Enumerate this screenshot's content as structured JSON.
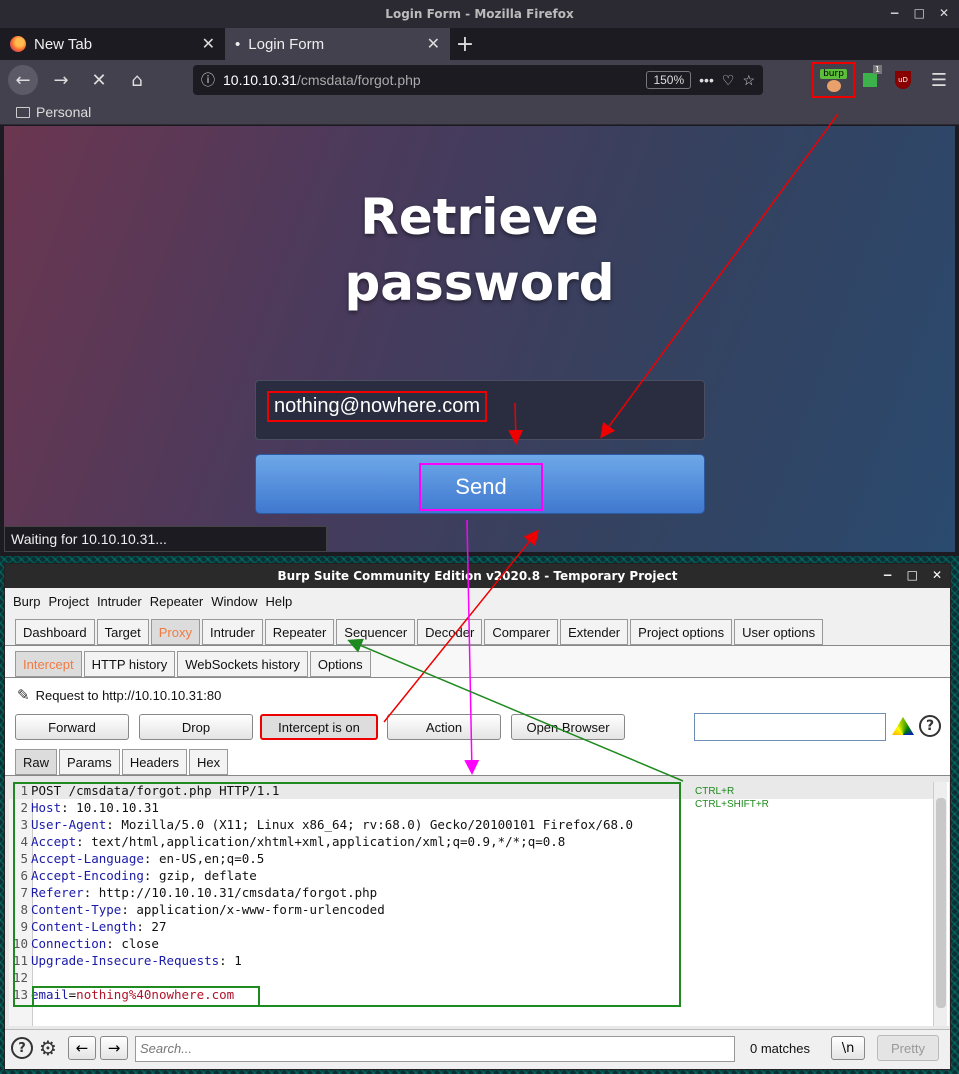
{
  "firefox": {
    "window_title": "Login Form - Mozilla Firefox",
    "tabs": [
      {
        "label": "New Tab"
      },
      {
        "label": "Login Form",
        "prefix": "•"
      }
    ],
    "url_host": "10.10.10.31",
    "url_path": "/cmsdata/forgot.php",
    "zoom": "150%",
    "burp_badge": "burp",
    "ext_count": "1",
    "ext_ub": "uD",
    "bookmark_folder": "Personal",
    "status_text": "Waiting for 10.10.10.31..."
  },
  "page": {
    "title_line1": "Retrieve",
    "title_line2": "password",
    "email_value": "nothing@nowhere.com",
    "send_label": "Send"
  },
  "burp": {
    "window_title": "Burp Suite Community Edition v2020.8 - Temporary Project",
    "menu": [
      "Burp",
      "Project",
      "Intruder",
      "Repeater",
      "Window",
      "Help"
    ],
    "main_tabs": [
      "Dashboard",
      "Target",
      "Proxy",
      "Intruder",
      "Repeater",
      "Sequencer",
      "Decoder",
      "Comparer",
      "Extender",
      "Project options",
      "User options"
    ],
    "sub_tabs": [
      "Intercept",
      "HTTP history",
      "WebSockets history",
      "Options"
    ],
    "request_to": "Request to http://10.10.10.31:80",
    "buttons": {
      "forward": "Forward",
      "drop": "Drop",
      "intercept": "Intercept is on",
      "action": "Action",
      "open_browser": "Open Browser"
    },
    "view_tabs": [
      "Raw",
      "Params",
      "Headers",
      "Hex"
    ],
    "request_lines": [
      {
        "n": "1",
        "key": "",
        "val": "POST /cmsdata/forgot.php HTTP/1.1"
      },
      {
        "n": "2",
        "key": "Host",
        "val": " 10.10.10.31"
      },
      {
        "n": "3",
        "key": "User-Agent",
        "val": " Mozilla/5.0 (X11; Linux x86_64; rv:68.0) Gecko/20100101 Firefox/68.0"
      },
      {
        "n": "4",
        "key": "Accept",
        "val": " text/html,application/xhtml+xml,application/xml;q=0.9,*/*;q=0.8"
      },
      {
        "n": "5",
        "key": "Accept-Language",
        "val": " en-US,en;q=0.5"
      },
      {
        "n": "6",
        "key": "Accept-Encoding",
        "val": " gzip, deflate"
      },
      {
        "n": "7",
        "key": "Referer",
        "val": " http://10.10.10.31/cmsdata/forgot.php"
      },
      {
        "n": "8",
        "key": "Content-Type",
        "val": " application/x-www-form-urlencoded"
      },
      {
        "n": "9",
        "key": "Content-Length",
        "val": " 27"
      },
      {
        "n": "10",
        "key": "Connection",
        "val": " close"
      },
      {
        "n": "11",
        "key": "Upgrade-Insecure-Requests",
        "val": " 1"
      },
      {
        "n": "12",
        "key": "",
        "val": ""
      },
      {
        "n": "13",
        "key": "email",
        "val": "nothing%40nowhere.com",
        "body": true
      }
    ],
    "shortcuts": [
      "CTRL+R",
      "CTRL+SHIFT+R"
    ],
    "search_placeholder": "Search...",
    "matches": "0 matches",
    "newline_btn": "\\n",
    "pretty_btn": "Pretty"
  },
  "colors": {
    "annotation_red": "#e00000",
    "annotation_magenta": "#ff00ff",
    "annotation_green": "#1f8a1f",
    "burp_selected_tab": "#f07a42"
  }
}
